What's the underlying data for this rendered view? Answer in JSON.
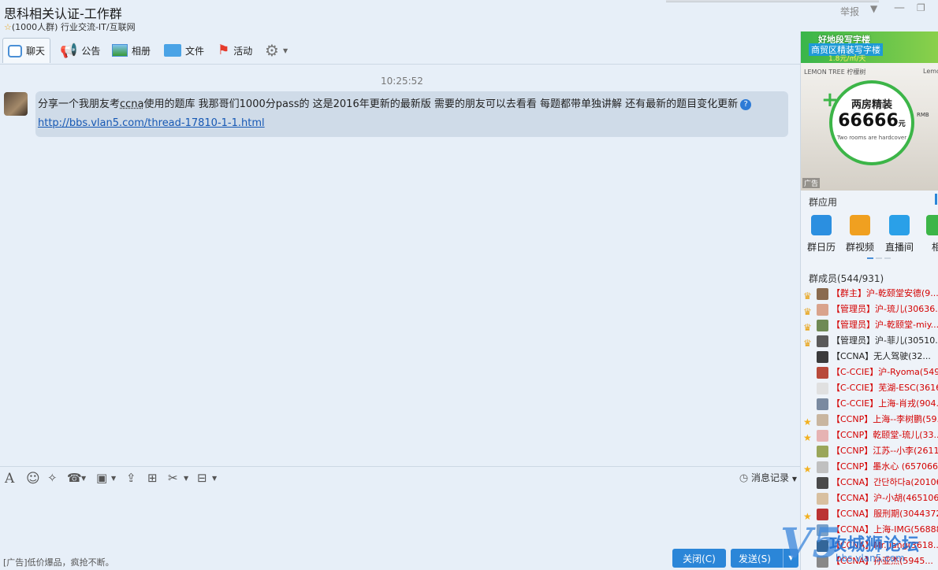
{
  "window": {
    "title": "思科相关认证-工作群",
    "group_size": "(1000人群)",
    "group_category": "行业交流-IT/互联网",
    "report": "举报"
  },
  "tabs": [
    {
      "label": "聊天",
      "icon": "chat-icon"
    },
    {
      "label": "公告",
      "icon": "announcement-icon"
    },
    {
      "label": "相册",
      "icon": "photo-album-icon"
    },
    {
      "label": "文件",
      "icon": "folder-icon"
    },
    {
      "label": "活动",
      "icon": "flag-icon"
    }
  ],
  "chat": {
    "timestamp": "10:25:52",
    "message_pre": "分享一个我朋友考",
    "message_term": "ccna",
    "message_post": "使用的题库 我那哥们1000分pass的 这是2016年更新的最新版 需要的朋友可以去看看 每题都带单独讲解 还有最新的题目变化更新",
    "message_link": "http://bbs.vlan5.com/thread-17810-1-1.html"
  },
  "toolbar": {
    "record": "消息记录"
  },
  "bottom": {
    "ad_text": "[广告]低价爆品，疯抢不断。",
    "close_button": "关闭(C)",
    "send_button": "发送(S)"
  },
  "ad": {
    "line1": "好地段写字楼",
    "line2": "商贸区精装写字楼",
    "line3": "1.8元/㎡/天",
    "brand": "LEMON TREE 柠檬树",
    "brand_right": "Lemo",
    "headline": "两房精装",
    "price": "66666",
    "price_unit_top": "RMB",
    "price_unit": "元",
    "tagline": "Two rooms are hardcover",
    "corner": "广告"
  },
  "group_apps": {
    "title": "群应用",
    "items": [
      {
        "label": "群日历",
        "color": "#2b8fe0"
      },
      {
        "label": "群视频",
        "color": "#f0a020"
      },
      {
        "label": "直播间",
        "color": "#2aa0e8"
      },
      {
        "label": "相",
        "color": "#3cb548"
      }
    ]
  },
  "members": {
    "title": "群成员(544/931)",
    "list": [
      {
        "text": "【群主】沪-乾颐堂安德(9...",
        "color": "red",
        "rank": "crown"
      },
      {
        "text": "【管理员】沪-琉儿(30636...",
        "color": "red",
        "rank": "crown"
      },
      {
        "text": "【管理员】沪-乾颐堂-miy...",
        "color": "red",
        "rank": "crown"
      },
      {
        "text": "【管理员】沪-菲儿(30510...",
        "color": "black",
        "rank": "crown"
      },
      {
        "text": "【CCNA】无人驾驶(32...",
        "color": "black",
        "rank": ""
      },
      {
        "text": "【C-CCIE】沪-Ryoma(5495...",
        "color": "red",
        "rank": ""
      },
      {
        "text": "【C-CCIE】芜湖-ESC(3616...",
        "color": "red",
        "rank": ""
      },
      {
        "text": "【C-CCIE】上海-肖戎(904...",
        "color": "red",
        "rank": ""
      },
      {
        "text": "【CCNP】上海--李树鹏(59...",
        "color": "red",
        "rank": "star"
      },
      {
        "text": "【CCNP】乾颐堂-琉儿(33...",
        "color": "red",
        "rank": "star"
      },
      {
        "text": "【CCNP】江苏--小李(2611...",
        "color": "red",
        "rank": ""
      },
      {
        "text": "【CCNP】墨水心 (6570661...",
        "color": "red",
        "rank": "star"
      },
      {
        "text": "【CCNA】간단하다a(20106...",
        "color": "red",
        "rank": ""
      },
      {
        "text": "【CCNA】沪-小胡(465106...",
        "color": "red",
        "rank": ""
      },
      {
        "text": "【CCNA】服刑期(3044372...",
        "color": "red",
        "rank": "star"
      },
      {
        "text": "【CCNA】上海-IMG(56888...",
        "color": "red",
        "rank": ""
      },
      {
        "text": "【CCNA】Mr.Jiang(3618...",
        "color": "red",
        "rank": ""
      },
      {
        "text": "【CCNA】孙亚杰(5945...",
        "color": "red",
        "rank": ""
      }
    ]
  },
  "watermark": {
    "logo": "V5",
    "text": "攻城狮论坛",
    "url": "bbs.vlan5.com"
  }
}
